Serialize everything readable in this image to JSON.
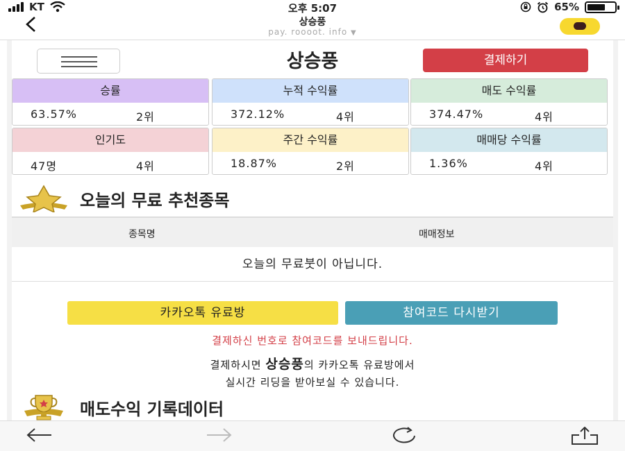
{
  "status": {
    "carrier": "KT",
    "time": "오후 5:07",
    "battery": "65%",
    "battery_level": 0.65
  },
  "nav": {
    "title": "상승풍",
    "url": "pay. roooot. info"
  },
  "header": {
    "title": "상승풍",
    "pay_label": "결제하기"
  },
  "stats": [
    {
      "label": "승률",
      "value": "63.57%",
      "rank": "2위",
      "color": "#d7bff5"
    },
    {
      "label": "누적 수익률",
      "value": "372.12%",
      "rank": "4위",
      "color": "#cfe1fb"
    },
    {
      "label": "매도 수익률",
      "value": "374.47%",
      "rank": "4위",
      "color": "#d6ecdb"
    },
    {
      "label": "인기도",
      "value": "47명",
      "rank": "4위",
      "color": "#f4d2d6"
    },
    {
      "label": "주간 수익률",
      "value": "18.87%",
      "rank": "2위",
      "color": "#fdf1c8"
    },
    {
      "label": "매매당 수익률",
      "value": "1.36%",
      "rank": "4위",
      "color": "#d3e8ee"
    }
  ],
  "recommend": {
    "title": "오늘의 무료 추천종목",
    "col_name": "종목명",
    "col_info": "매매정보",
    "empty": "오늘의 무료붓이 아닙니다."
  },
  "actions": {
    "kakao_label": "카카오톡 유료방",
    "code_label": "참여코드 다시받기",
    "notice": "결제하신 번호로 참여코드를 보내드립니다.",
    "desc_pre": "결제하시면 ",
    "desc_name": "상승풍",
    "desc_post": "의 카카오톡 유료방에서",
    "desc_line2": "실시간 리딩을 받아보실 수 있습니다."
  },
  "records": {
    "title": "매도수익 기록데이터"
  },
  "icons": {
    "back": "chevron-left-icon",
    "talk": "chat-bubble-icon",
    "menu": "hamburger-icon",
    "star": "gold-star-badge-icon",
    "trophy": "gold-trophy-icon"
  }
}
